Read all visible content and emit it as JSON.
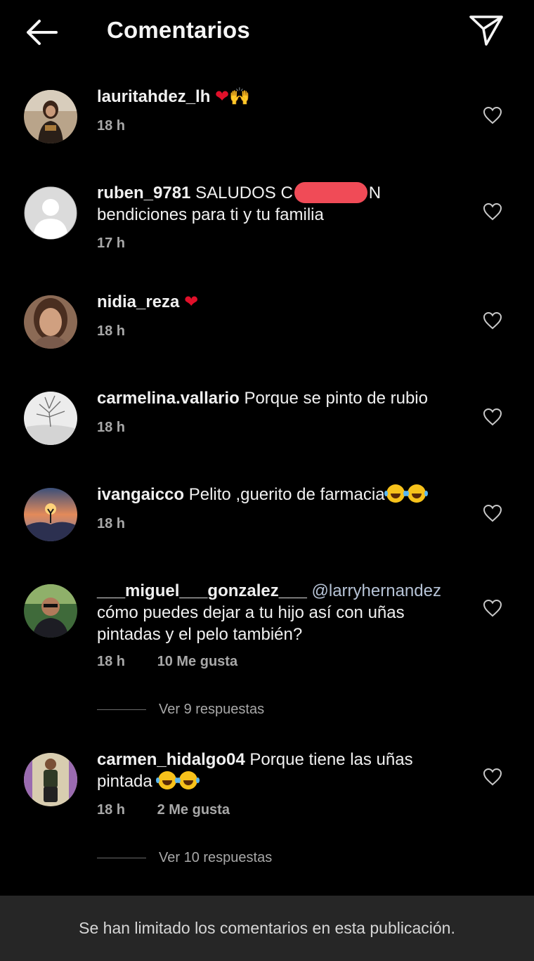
{
  "header": {
    "title": "Comentarios",
    "back_icon": "arrow-left-icon",
    "send_icon": "paper-plane-icon"
  },
  "comments": [
    {
      "username": "lauritahdez_lh",
      "text": "",
      "emojis": [
        "❤",
        "🙌"
      ],
      "time": "18 h",
      "likes": "",
      "avatar": "photo-woman"
    },
    {
      "username": "ruben_9781",
      "text_before": "SALUDOS C",
      "text_after": "N bendiciones para  ti y tu familia",
      "time": "17 h",
      "likes": "",
      "avatar": "default-user"
    },
    {
      "username": "nidia_reza",
      "text": "",
      "emojis": [
        "❤"
      ],
      "time": "18 h",
      "likes": "",
      "avatar": "photo-woman"
    },
    {
      "username": "carmelina.vallario",
      "text": "Porque se pinto de rubio",
      "time": "18 h",
      "likes": "",
      "avatar": "winter-tree"
    },
    {
      "username": "ivangaicco",
      "text": "Pelito ,guerito de farmacia",
      "emojis": [
        "😂",
        "😂"
      ],
      "time": "18 h",
      "likes": "",
      "avatar": "sunset-deer"
    },
    {
      "username": "___miguel___gonzalez___",
      "mention": "@larryhernandez",
      "text": "cómo puedes dejar a tu hijo así con uñas pintadas y el pelo también?",
      "time": "18 h",
      "likes": "10 Me gusta",
      "replies": "Ver 9 respuestas",
      "avatar": "photo-man"
    },
    {
      "username": "carmen_hidalgo04",
      "text": "Porque tiene las uñas pintada",
      "emojis": [
        "😂",
        "😂"
      ],
      "time": "18 h",
      "likes": "2 Me gusta",
      "replies": "Ver 10 respuestas",
      "avatar": "photo-woman-full"
    }
  ],
  "footer": {
    "notice": "Se han limitado los comentarios en esta publicación."
  },
  "colors": {
    "background": "#000000",
    "text": "#f5f5f5",
    "muted": "#a8a8a8",
    "footer_bg": "#262626",
    "redaction": "#f04b57"
  }
}
